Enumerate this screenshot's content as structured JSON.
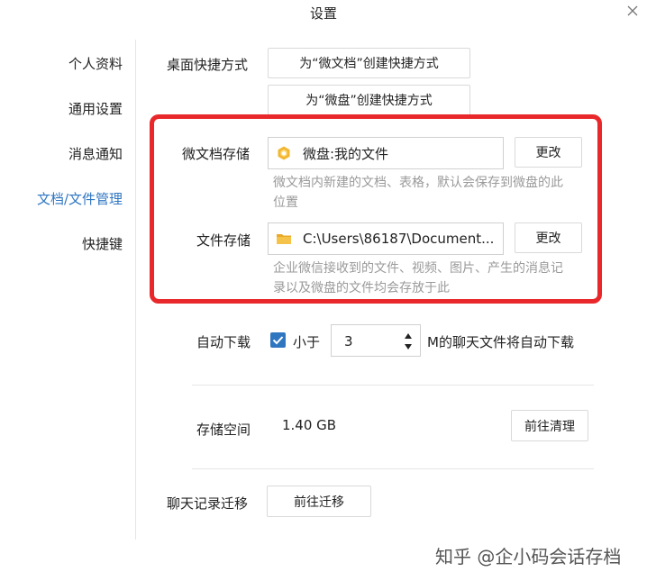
{
  "window": {
    "title": "设置"
  },
  "sidebar": {
    "items": [
      {
        "label": "个人资料"
      },
      {
        "label": "通用设置"
      },
      {
        "label": "消息通知"
      },
      {
        "label": "文档/文件管理"
      },
      {
        "label": "快捷键"
      }
    ],
    "active_index": 3
  },
  "shortcut": {
    "label": "桌面快捷方式",
    "btn_doc": "为“微文档”创建快捷方式",
    "btn_drive": "为“微盘”创建快捷方式"
  },
  "doc_storage": {
    "label": "微文档存储",
    "path": "微盘:我的文件",
    "change_label": "更改",
    "desc": "微文档内新建的文档、表格，默认会保存到微盘的此位置"
  },
  "file_storage": {
    "label": "文件存储",
    "path": "C:\\Users\\86187\\Document...",
    "change_label": "更改",
    "desc": "企业微信接收到的文件、视频、图片、产生的消息记录以及微盘的文件均会存放于此"
  },
  "auto_download": {
    "label": "自动下载",
    "checked": true,
    "less_than": "小于",
    "size": "3",
    "suffix": "M的聊天文件将自动下载"
  },
  "storage": {
    "label": "存储空间",
    "value": "1.40 GB",
    "clean_label": "前往清理"
  },
  "migrate": {
    "label": "聊天记录迁移",
    "btn_label": "前往迁移"
  },
  "watermark": {
    "text": "知乎 @企小码会话存档"
  },
  "colors": {
    "accent": "#2f76c1",
    "highlight": "#e8282a",
    "drive_icon": "#f2b630",
    "folder_icon": "#f2b630"
  }
}
